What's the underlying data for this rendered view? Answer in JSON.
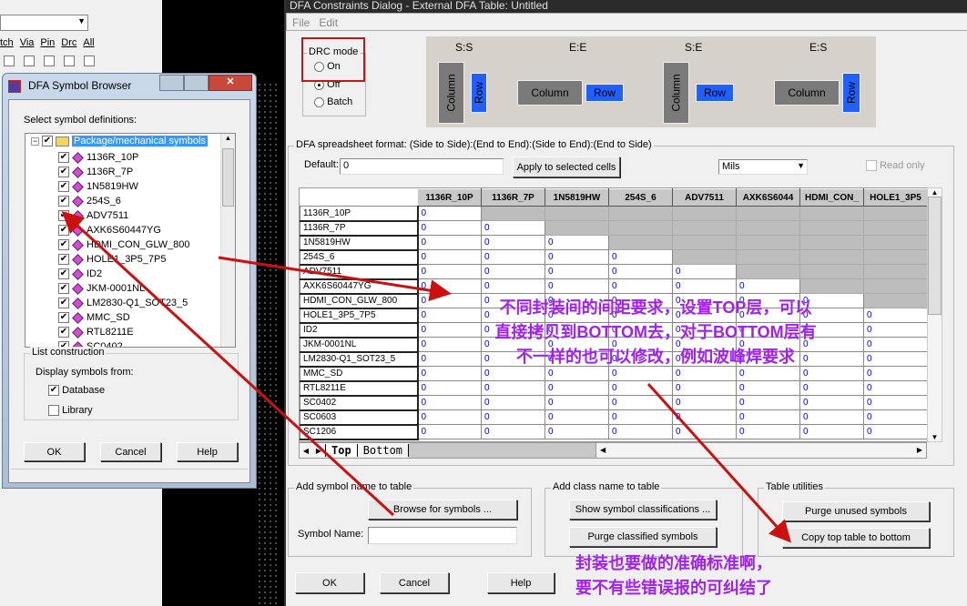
{
  "bg_window": {
    "labels": [
      "tch",
      "Via",
      "Pin",
      "Drc",
      "All"
    ]
  },
  "browser": {
    "title": "DFA Symbol Browser",
    "select_label": "Select symbol definitions:",
    "root": "Package/mechanical symbols",
    "items": [
      "1136R_10P",
      "1136R_7P",
      "1N5819HW",
      "254S_6",
      "ADV7511",
      "AXK6S60447YG",
      "HDMI_CON_GLW_800",
      "HOLE1_3P5_7P5",
      "ID2",
      "JKM-0001NL",
      "LM2830-Q1_SOT23_5",
      "MMC_SD",
      "RTL8211E",
      "SC0402"
    ],
    "list_construction": "List construction",
    "display_from": "Display symbols from:",
    "database": "Database",
    "database_checked": true,
    "library": "Library",
    "library_checked": false,
    "ok": "OK",
    "cancel": "Cancel",
    "help": "Help"
  },
  "dialog": {
    "title": "DFA Constraints Dialog - External DFA Table: Untitled",
    "menu": [
      "File",
      "Edit"
    ],
    "drc": {
      "label": "DRC mode",
      "options": [
        "On",
        "Off",
        "Batch"
      ],
      "selected": "Off"
    },
    "diagram": {
      "labels": [
        "S:S",
        "E:E",
        "S:E",
        "E:S"
      ],
      "column": "Column",
      "row": "Row"
    },
    "format_label": "DFA spreadsheet format:  (Side to Side):(End to End):(Side to End):(End to Side)",
    "default_label": "Default:",
    "default_value": "0",
    "apply": "Apply to selected cells",
    "units": "Mils",
    "read_only": "Read only",
    "columns": [
      "1136R_10P",
      "1136R_7P",
      "1N5819HW",
      "254S_6",
      "ADV7511",
      "AXK6S6044",
      "HDMI_CON_",
      "HOLE1_3P5"
    ],
    "rows": [
      "1136R_10P",
      "1136R_7P",
      "1N5819HW",
      "254S_6",
      "ADV7511",
      "AXK6S60447YG",
      "HDMI_CON_GLW_800",
      "HOLE1_3P5_7P5",
      "ID2",
      "JKM-0001NL",
      "LM2830-Q1_SOT23_5",
      "MMC_SD",
      "RTL8211E",
      "SC0402",
      "SC0603",
      "SC1206"
    ],
    "cell_value": "0",
    "tabs": [
      "Top",
      "Bottom"
    ],
    "active_tab": "Top",
    "add_symbol": {
      "label": "Add symbol name to table",
      "browse": "Browse for symbols ...",
      "name_label": "Symbol Name:",
      "name_value": ""
    },
    "add_class": {
      "label": "Add class name to table",
      "show": "Show symbol classifications ...",
      "purge": "Purge classified symbols"
    },
    "utilities": {
      "label": "Table utilities",
      "purge_unused": "Purge unused symbols",
      "copy": "Copy top table to bottom"
    },
    "ok": "OK",
    "cancel": "Cancel",
    "help": "Help"
  },
  "annotations": {
    "note1": [
      "不同封装间的间距要求，设置TOP层，可以",
      "直接拷贝到BOTTOM去，对于BOTTOM层有",
      "不一样的也可以修改，例如波峰焊要求"
    ],
    "note2": [
      "封装也要做的准确标准啊，",
      "要不有些错误报的可纠结了"
    ]
  },
  "colors": {
    "accent_blue": "#2060ff",
    "annotation": "#a020f0",
    "arrow": "#cc1010",
    "highlight": "#3399ff"
  }
}
